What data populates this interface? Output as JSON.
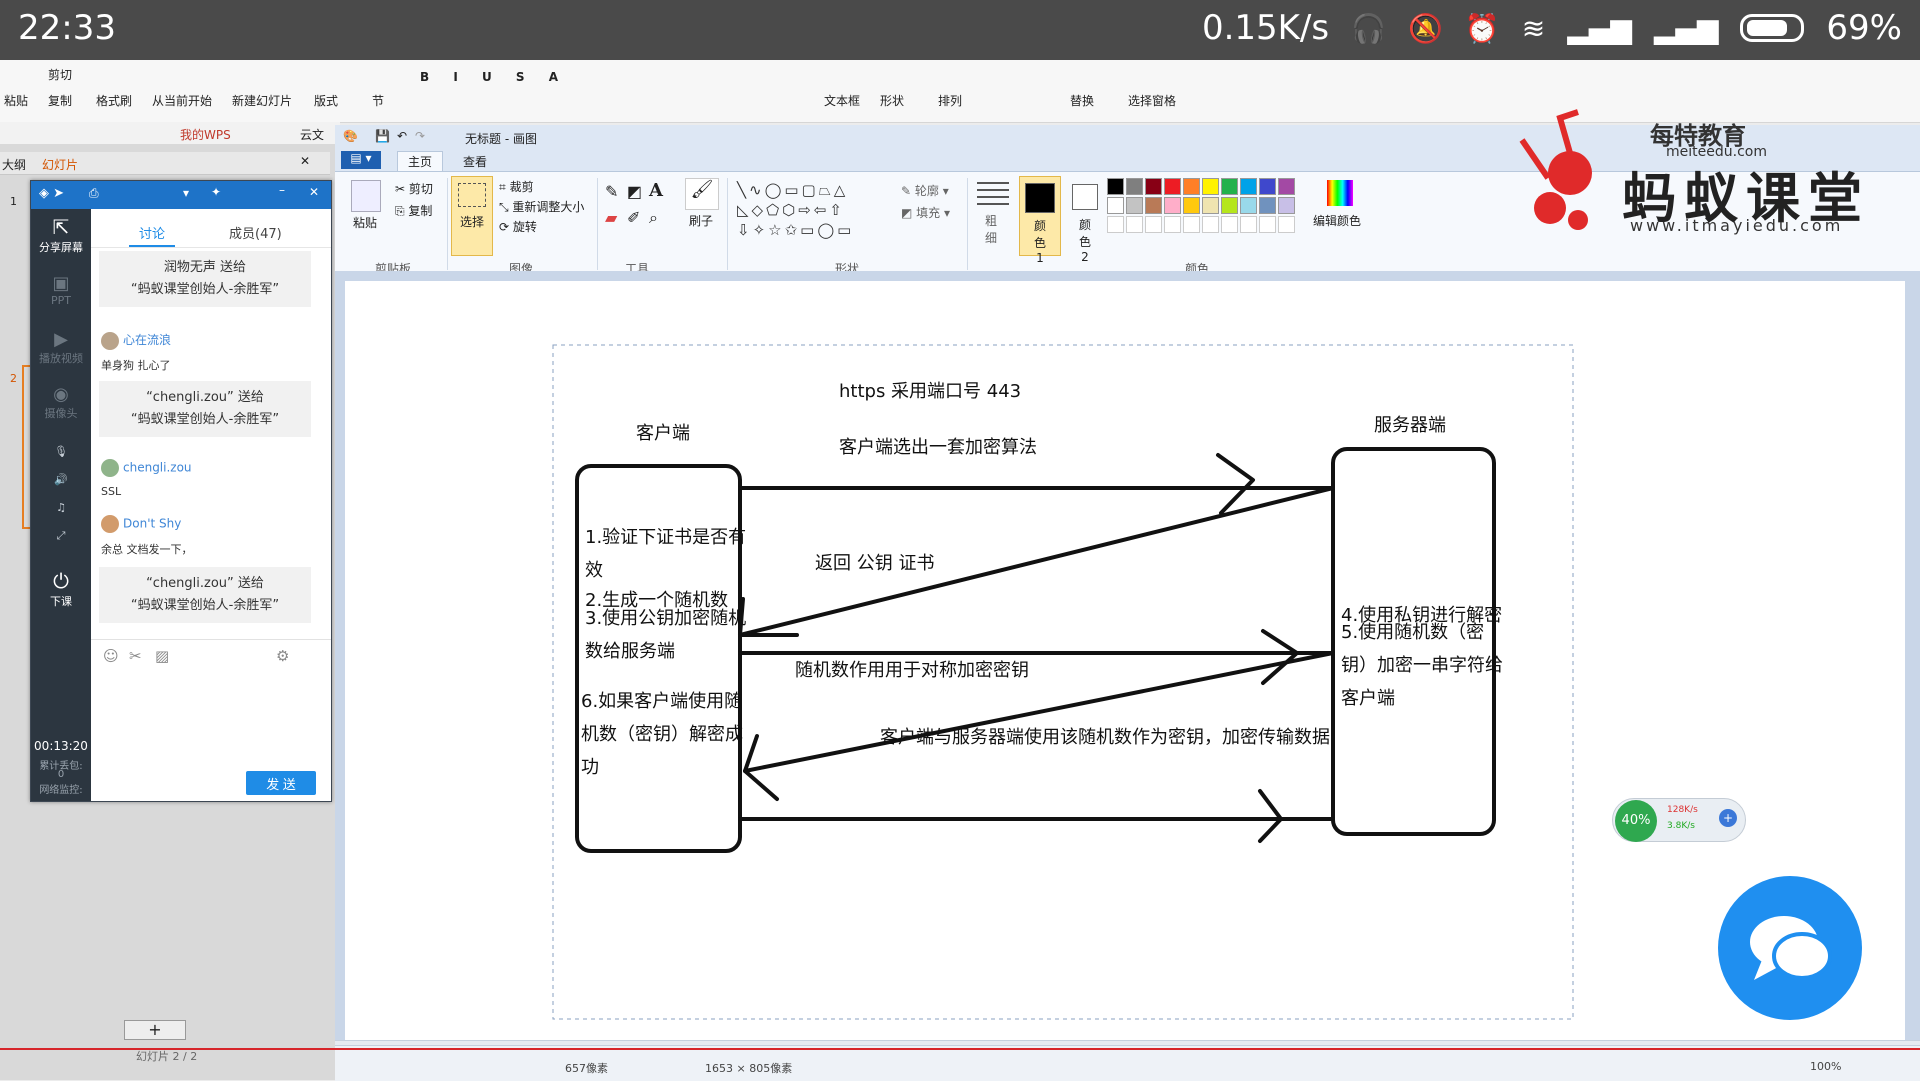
{
  "statusbar": {
    "time": "22:33",
    "speed": "0.15K/s",
    "battery": "69%"
  },
  "wps": {
    "ribbon_items": [
      "粘贴",
      "剪切",
      "复制",
      "格式刷",
      "从当前开始",
      "新建幻灯片",
      "版式",
      "节",
      "文本框",
      "形状",
      "排列",
      "替换",
      "选择窗格"
    ],
    "quick_access": [
      "我的WPS",
      "云文"
    ],
    "left_tabs": [
      "大纲",
      "幻灯片"
    ],
    "slide_counter": "幻灯片 2 / 2"
  },
  "chat": {
    "tabs": [
      "讨论",
      "成员(47)"
    ],
    "side_items": [
      "分享屏幕",
      "PPT",
      "播放视频",
      "摄像头",
      "下课"
    ],
    "timer": "00:13:20",
    "stats": [
      "累计丢包:",
      "0",
      "网络监控:"
    ],
    "messages": [
      {
        "type": "gift",
        "lines": [
          "润物无声  送给",
          "“蚂蚁课堂创始人-余胜军”"
        ]
      },
      {
        "type": "user",
        "user": "心在流浪",
        "text": "单身狗 扎心了"
      },
      {
        "type": "gift",
        "lines": [
          "“chengli.zou” 送给",
          "“蚂蚁课堂创始人-余胜军”"
        ]
      },
      {
        "type": "user",
        "user": "chengli.zou",
        "text": "SSL"
      },
      {
        "type": "user",
        "user": "Don't Shy",
        "text": "余总 文档发一下，"
      },
      {
        "type": "gift",
        "lines": [
          "“chengli.zou” 送给",
          "“蚂蚁课堂创始人-余胜军”"
        ]
      }
    ],
    "send_label": "发 送"
  },
  "paint": {
    "title": "无标题 - 画图",
    "tabs": [
      "主页",
      "查看"
    ],
    "groups": [
      "剪贴板",
      "图像",
      "工具",
      "形状",
      "颜色"
    ],
    "clipboard": {
      "paste": "粘贴",
      "cut": "剪切",
      "copy": "复制"
    },
    "image": {
      "select": "选择",
      "crop": "裁剪",
      "resize": "重新调整大小",
      "rotate": "旋转"
    },
    "brush": "刷子",
    "outline": "轮廓",
    "fill": "填充",
    "size": "粗细",
    "color1": "颜色 1",
    "color2": "颜色 2",
    "edit_colors": "编辑颜色",
    "palette": [
      "#000000",
      "#7f7f7f",
      "#880015",
      "#ed1c24",
      "#ff7f27",
      "#fff200",
      "#22b14c",
      "#00a2e8",
      "#3f48cc",
      "#a349a4",
      "#ffffff",
      "#c3c3c3",
      "#b97a57",
      "#ffaec9",
      "#ffc90e",
      "#efe4b0",
      "#b5e61d",
      "#99d9ea",
      "#7092be",
      "#c8bfe7"
    ],
    "status": [
      "657像素",
      "1653 × 805像素",
      "100%"
    ]
  },
  "diagram": {
    "title": "https  采用端口号 443",
    "client_label": "客户端",
    "server_label": "服务器端",
    "step_client_choose": "客户端选出一套加密算法",
    "step_return_key": "返回 公钥 证书",
    "client_steps": [
      "1.验证下证书是否有效",
      "2.生成一个随机数",
      "3.使用公钥加密随机数给服务端"
    ],
    "random_use": "随机数作用用于对称加密密钥",
    "server_steps": [
      "4.使用私钥进行解密",
      "5.使用随机数（密钥）加密一串字符给客户端"
    ],
    "client_step6": "6.如果客户端使用随机数（密钥）解密成功",
    "final_note": "客户端与服务器端使用该随机数作为密钥，加密传输数据"
  },
  "logo": {
    "name": "蚂蚁课堂",
    "url": "www.itmayiedu.com",
    "brand": "每特教育",
    "brand_url": "meiteedu.com"
  },
  "net": {
    "percent": "40%",
    "up": "128K/s",
    "down": "3.8K/s"
  },
  "colors": {
    "accent": "#1f8ce6",
    "logo_red": "#e02a2a",
    "statusbar": "#4a4a4a"
  }
}
